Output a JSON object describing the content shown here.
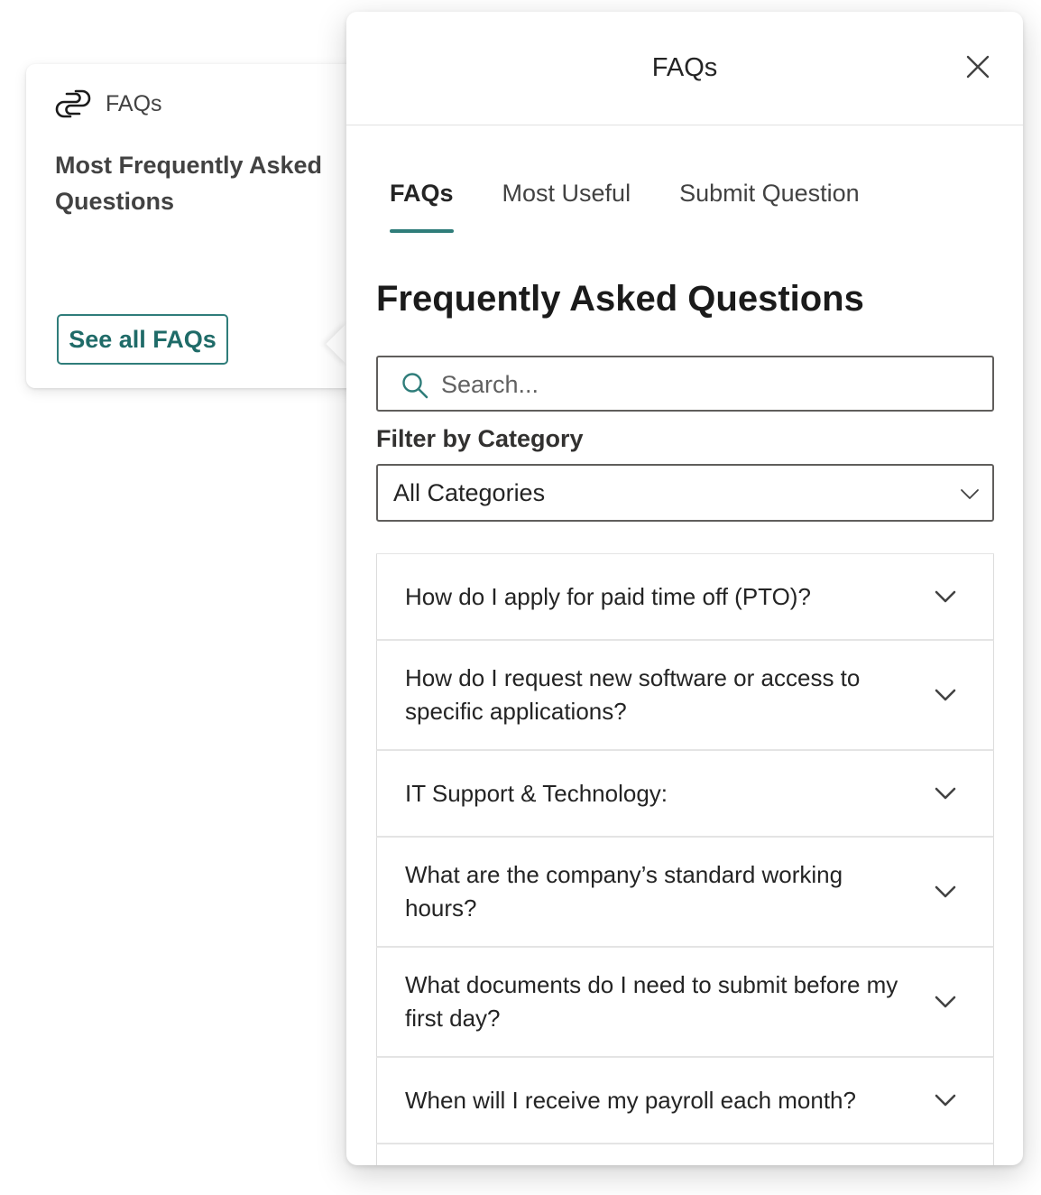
{
  "card": {
    "header_label": "FAQs",
    "title": "Most Frequently Asked Questions",
    "see_all_label": "See all FAQs",
    "logo_icon": "paperclip-logo-icon"
  },
  "panel": {
    "title": "FAQs",
    "close_icon": "close-icon",
    "tabs": [
      {
        "label": "FAQs",
        "active": true
      },
      {
        "label": "Most Useful",
        "active": false
      },
      {
        "label": "Submit Question",
        "active": false
      }
    ],
    "heading": "Frequently Asked Questions",
    "search": {
      "placeholder": "Search...",
      "value": "",
      "icon": "search-icon"
    },
    "filter": {
      "label": "Filter by Category",
      "selected": "All Categories"
    },
    "faqs": [
      "How do I apply for paid time off (PTO)?",
      "How do I request new software or access to specific applications?",
      "IT Support & Technology:",
      "What are the company’s standard working hours?",
      "What documents do I need to submit before my first day?",
      "When will I receive my payroll each month?"
    ]
  },
  "colors": {
    "accent": "#2f7d7a",
    "accent_text": "#1f6b68",
    "text": "#242424",
    "border": "#605e5c"
  }
}
